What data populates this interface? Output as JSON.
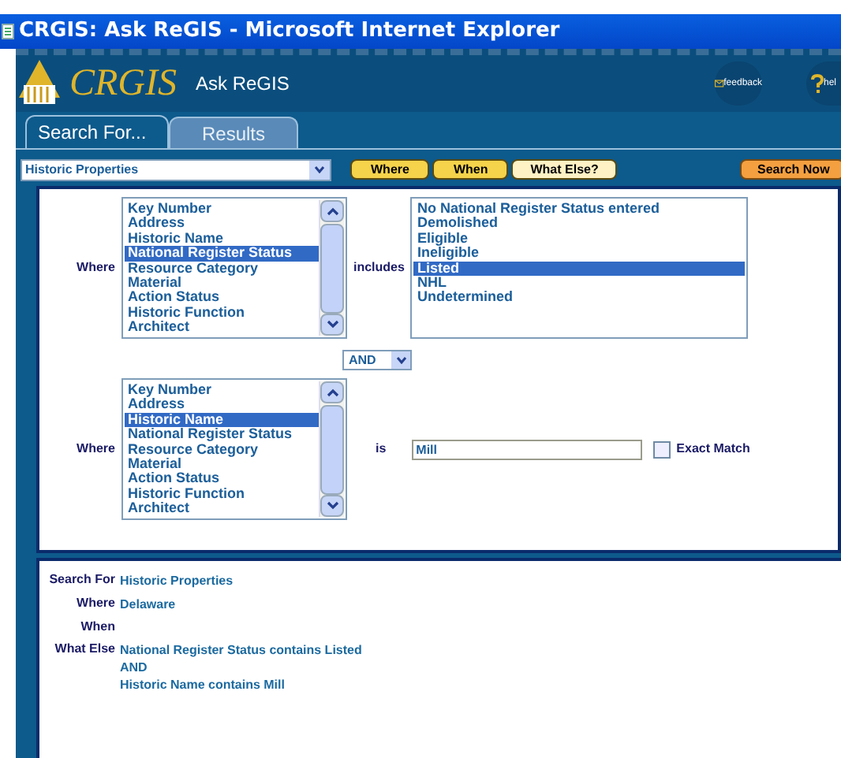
{
  "window": {
    "title": "CRGIS: Ask ReGIS - Microsoft Internet Explorer"
  },
  "header": {
    "logo": "CRGIS",
    "app_name": "Ask ReGIS",
    "feedback": "feedback",
    "help": "hel"
  },
  "tabs": [
    {
      "label": "Search For...",
      "selected": true
    },
    {
      "label": "Results",
      "selected": false
    }
  ],
  "search_for": {
    "value": "Historic Properties"
  },
  "toolbar": [
    {
      "label": "Where",
      "selected": false
    },
    {
      "label": "When",
      "selected": false
    },
    {
      "label": "What Else?",
      "selected": true
    }
  ],
  "search_button": "Search Now",
  "criteria": [
    {
      "kind": "list",
      "label": "Where",
      "relation": "includes",
      "fields": [
        {
          "label": "Key Number",
          "selected": false
        },
        {
          "label": "Address",
          "selected": false
        },
        {
          "label": "Historic Name",
          "selected": false
        },
        {
          "label": "National Register Status",
          "selected": true
        },
        {
          "label": "Resource Category",
          "selected": false
        },
        {
          "label": "Material",
          "selected": false
        },
        {
          "label": "Action Status",
          "selected": false
        },
        {
          "label": "Historic Function",
          "selected": false
        },
        {
          "label": "Architect",
          "selected": false
        }
      ],
      "values": [
        {
          "label": "No National Register Status entered",
          "selected": false
        },
        {
          "label": "Demolished",
          "selected": false
        },
        {
          "label": "Eligible",
          "selected": false
        },
        {
          "label": "Ineligible",
          "selected": false
        },
        {
          "label": "Listed",
          "selected": true
        },
        {
          "label": "NHL",
          "selected": false
        },
        {
          "label": "Undetermined",
          "selected": false
        }
      ]
    },
    {
      "kind": "text",
      "label": "Where",
      "relation": "is",
      "fields": [
        {
          "label": "Key Number",
          "selected": false
        },
        {
          "label": "Address",
          "selected": false
        },
        {
          "label": "Historic Name",
          "selected": true
        },
        {
          "label": "National Register Status",
          "selected": false
        },
        {
          "label": "Resource Category",
          "selected": false
        },
        {
          "label": "Material",
          "selected": false
        },
        {
          "label": "Action Status",
          "selected": false
        },
        {
          "label": "Historic Function",
          "selected": false
        },
        {
          "label": "Architect",
          "selected": false
        }
      ],
      "value": "Mill",
      "exact_match": {
        "label": "Exact Match",
        "checked": false
      }
    }
  ],
  "connector": "AND",
  "summary": [
    {
      "label": "Search For",
      "lines": [
        "Historic Properties"
      ]
    },
    {
      "label": "Where",
      "lines": [
        "Delaware"
      ]
    },
    {
      "label": "When"
    },
    {
      "label": "What Else",
      "lines": [
        "National Register Status contains Listed",
        "AND",
        "Historic Name contains Mill"
      ]
    }
  ]
}
